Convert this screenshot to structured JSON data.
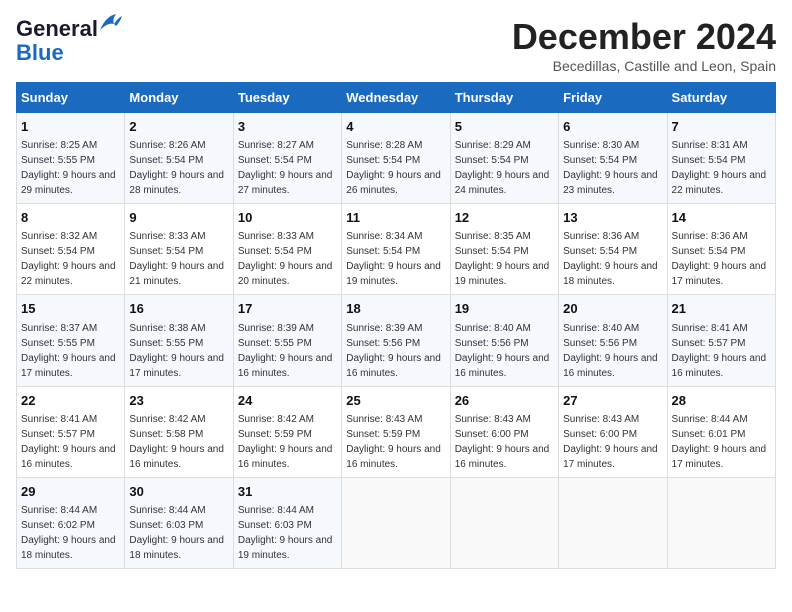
{
  "logo": {
    "line1": "General",
    "line2": "Blue",
    "icon": "▶"
  },
  "title": "December 2024",
  "subtitle": "Becedillas, Castille and Leon, Spain",
  "days_of_week": [
    "Sunday",
    "Monday",
    "Tuesday",
    "Wednesday",
    "Thursday",
    "Friday",
    "Saturday"
  ],
  "weeks": [
    [
      {
        "day": 1,
        "sunrise": "8:25 AM",
        "sunset": "5:55 PM",
        "daylight": "9 hours and 29 minutes."
      },
      {
        "day": 2,
        "sunrise": "8:26 AM",
        "sunset": "5:54 PM",
        "daylight": "9 hours and 28 minutes."
      },
      {
        "day": 3,
        "sunrise": "8:27 AM",
        "sunset": "5:54 PM",
        "daylight": "9 hours and 27 minutes."
      },
      {
        "day": 4,
        "sunrise": "8:28 AM",
        "sunset": "5:54 PM",
        "daylight": "9 hours and 26 minutes."
      },
      {
        "day": 5,
        "sunrise": "8:29 AM",
        "sunset": "5:54 PM",
        "daylight": "9 hours and 24 minutes."
      },
      {
        "day": 6,
        "sunrise": "8:30 AM",
        "sunset": "5:54 PM",
        "daylight": "9 hours and 23 minutes."
      },
      {
        "day": 7,
        "sunrise": "8:31 AM",
        "sunset": "5:54 PM",
        "daylight": "9 hours and 22 minutes."
      }
    ],
    [
      {
        "day": 8,
        "sunrise": "8:32 AM",
        "sunset": "5:54 PM",
        "daylight": "9 hours and 22 minutes."
      },
      {
        "day": 9,
        "sunrise": "8:33 AM",
        "sunset": "5:54 PM",
        "daylight": "9 hours and 21 minutes."
      },
      {
        "day": 10,
        "sunrise": "8:33 AM",
        "sunset": "5:54 PM",
        "daylight": "9 hours and 20 minutes."
      },
      {
        "day": 11,
        "sunrise": "8:34 AM",
        "sunset": "5:54 PM",
        "daylight": "9 hours and 19 minutes."
      },
      {
        "day": 12,
        "sunrise": "8:35 AM",
        "sunset": "5:54 PM",
        "daylight": "9 hours and 19 minutes."
      },
      {
        "day": 13,
        "sunrise": "8:36 AM",
        "sunset": "5:54 PM",
        "daylight": "9 hours and 18 minutes."
      },
      {
        "day": 14,
        "sunrise": "8:36 AM",
        "sunset": "5:54 PM",
        "daylight": "9 hours and 17 minutes."
      }
    ],
    [
      {
        "day": 15,
        "sunrise": "8:37 AM",
        "sunset": "5:55 PM",
        "daylight": "9 hours and 17 minutes."
      },
      {
        "day": 16,
        "sunrise": "8:38 AM",
        "sunset": "5:55 PM",
        "daylight": "9 hours and 17 minutes."
      },
      {
        "day": 17,
        "sunrise": "8:39 AM",
        "sunset": "5:55 PM",
        "daylight": "9 hours and 16 minutes."
      },
      {
        "day": 18,
        "sunrise": "8:39 AM",
        "sunset": "5:56 PM",
        "daylight": "9 hours and 16 minutes."
      },
      {
        "day": 19,
        "sunrise": "8:40 AM",
        "sunset": "5:56 PM",
        "daylight": "9 hours and 16 minutes."
      },
      {
        "day": 20,
        "sunrise": "8:40 AM",
        "sunset": "5:56 PM",
        "daylight": "9 hours and 16 minutes."
      },
      {
        "day": 21,
        "sunrise": "8:41 AM",
        "sunset": "5:57 PM",
        "daylight": "9 hours and 16 minutes."
      }
    ],
    [
      {
        "day": 22,
        "sunrise": "8:41 AM",
        "sunset": "5:57 PM",
        "daylight": "9 hours and 16 minutes."
      },
      {
        "day": 23,
        "sunrise": "8:42 AM",
        "sunset": "5:58 PM",
        "daylight": "9 hours and 16 minutes."
      },
      {
        "day": 24,
        "sunrise": "8:42 AM",
        "sunset": "5:59 PM",
        "daylight": "9 hours and 16 minutes."
      },
      {
        "day": 25,
        "sunrise": "8:43 AM",
        "sunset": "5:59 PM",
        "daylight": "9 hours and 16 minutes."
      },
      {
        "day": 26,
        "sunrise": "8:43 AM",
        "sunset": "6:00 PM",
        "daylight": "9 hours and 16 minutes."
      },
      {
        "day": 27,
        "sunrise": "8:43 AM",
        "sunset": "6:00 PM",
        "daylight": "9 hours and 17 minutes."
      },
      {
        "day": 28,
        "sunrise": "8:44 AM",
        "sunset": "6:01 PM",
        "daylight": "9 hours and 17 minutes."
      }
    ],
    [
      {
        "day": 29,
        "sunrise": "8:44 AM",
        "sunset": "6:02 PM",
        "daylight": "9 hours and 18 minutes."
      },
      {
        "day": 30,
        "sunrise": "8:44 AM",
        "sunset": "6:03 PM",
        "daylight": "9 hours and 18 minutes."
      },
      {
        "day": 31,
        "sunrise": "8:44 AM",
        "sunset": "6:03 PM",
        "daylight": "9 hours and 19 minutes."
      },
      null,
      null,
      null,
      null
    ]
  ]
}
